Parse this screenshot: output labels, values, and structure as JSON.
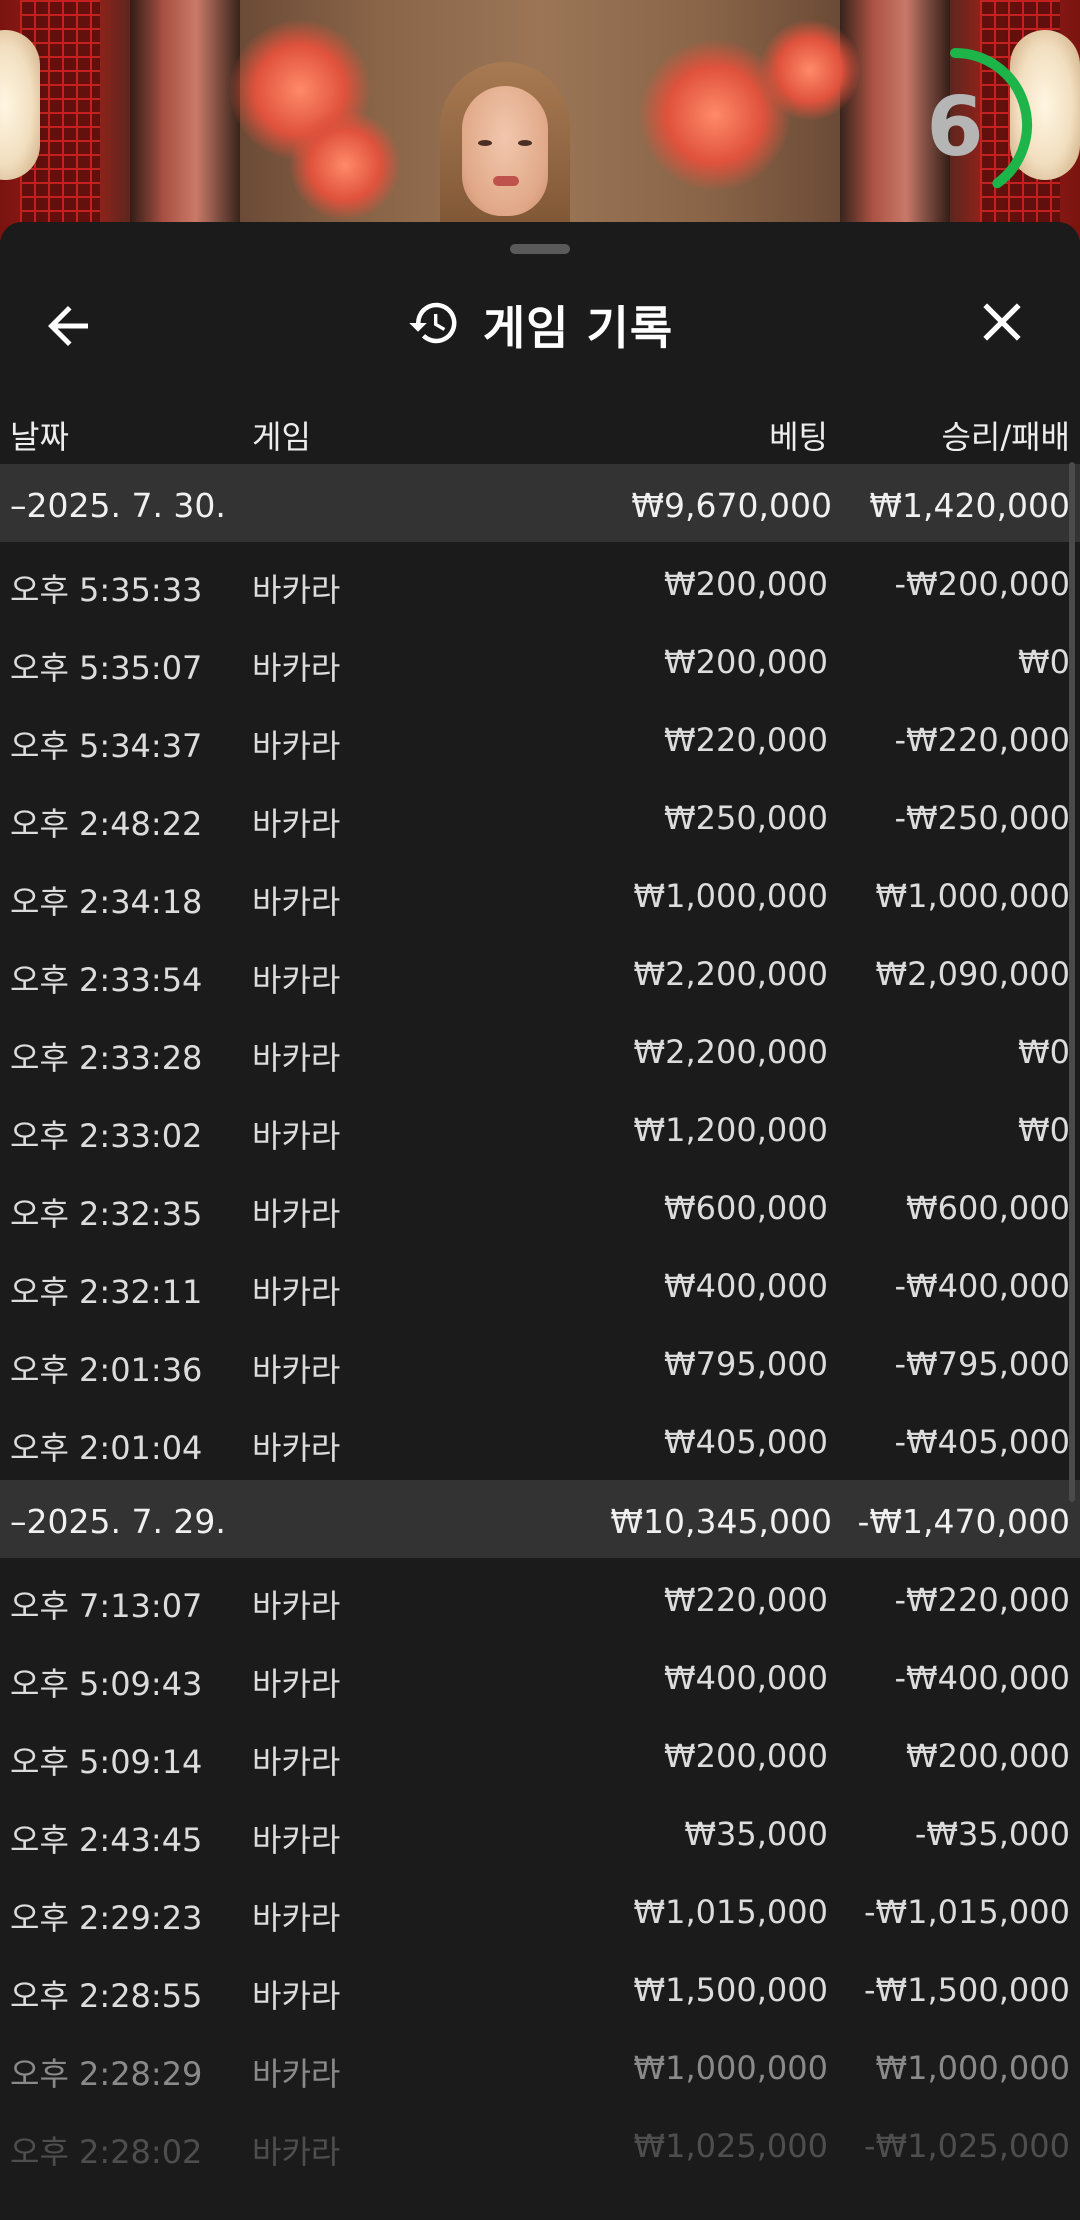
{
  "timer": {
    "value": "6",
    "fraction_remaining": 0.4,
    "color": "#1db44a"
  },
  "header": {
    "title": "게임 기록",
    "icons": {
      "back": "arrow-left-icon",
      "title": "history-icon",
      "close": "close-icon"
    }
  },
  "columns": {
    "date": "날짜",
    "game": "게임",
    "bet": "베팅",
    "result": "승리/패배"
  },
  "groups": [
    {
      "date": "–2025. 7. 30.",
      "total_bet": "₩9,670,000",
      "total_result": "₩1,420,000",
      "rows": [
        {
          "time": "오후 5:35:33",
          "game": "바카라",
          "bet": "₩200,000",
          "result": "-₩200,000"
        },
        {
          "time": "오후 5:35:07",
          "game": "바카라",
          "bet": "₩200,000",
          "result": "₩0"
        },
        {
          "time": "오후 5:34:37",
          "game": "바카라",
          "bet": "₩220,000",
          "result": "-₩220,000"
        },
        {
          "time": "오후 2:48:22",
          "game": "바카라",
          "bet": "₩250,000",
          "result": "-₩250,000"
        },
        {
          "time": "오후 2:34:18",
          "game": "바카라",
          "bet": "₩1,000,000",
          "result": "₩1,000,000"
        },
        {
          "time": "오후 2:33:54",
          "game": "바카라",
          "bet": "₩2,200,000",
          "result": "₩2,090,000"
        },
        {
          "time": "오후 2:33:28",
          "game": "바카라",
          "bet": "₩2,200,000",
          "result": "₩0"
        },
        {
          "time": "오후 2:33:02",
          "game": "바카라",
          "bet": "₩1,200,000",
          "result": "₩0"
        },
        {
          "time": "오후 2:32:35",
          "game": "바카라",
          "bet": "₩600,000",
          "result": "₩600,000"
        },
        {
          "time": "오후 2:32:11",
          "game": "바카라",
          "bet": "₩400,000",
          "result": "-₩400,000"
        },
        {
          "time": "오후 2:01:36",
          "game": "바카라",
          "bet": "₩795,000",
          "result": "-₩795,000"
        },
        {
          "time": "오후 2:01:04",
          "game": "바카라",
          "bet": "₩405,000",
          "result": "-₩405,000"
        }
      ]
    },
    {
      "date": "–2025. 7. 29.",
      "total_bet": "₩10,345,000",
      "total_result": "-₩1,470,000",
      "rows": [
        {
          "time": "오후 7:13:07",
          "game": "바카라",
          "bet": "₩220,000",
          "result": "-₩220,000"
        },
        {
          "time": "오후 5:09:43",
          "game": "바카라",
          "bet": "₩400,000",
          "result": "-₩400,000"
        },
        {
          "time": "오후 5:09:14",
          "game": "바카라",
          "bet": "₩200,000",
          "result": "₩200,000"
        },
        {
          "time": "오후 2:43:45",
          "game": "바카라",
          "bet": "₩35,000",
          "result": "-₩35,000"
        },
        {
          "time": "오후 2:29:23",
          "game": "바카라",
          "bet": "₩1,015,000",
          "result": "-₩1,015,000"
        },
        {
          "time": "오후 2:28:55",
          "game": "바카라",
          "bet": "₩1,500,000",
          "result": "-₩1,500,000"
        },
        {
          "time": "오후 2:28:29",
          "game": "바카라",
          "bet": "₩1,000,000",
          "result": "₩1,000,000"
        },
        {
          "time": "오후 2:28:02",
          "game": "바카라",
          "bet": "₩1,025,000",
          "result": "-₩1,025,000"
        }
      ]
    }
  ]
}
